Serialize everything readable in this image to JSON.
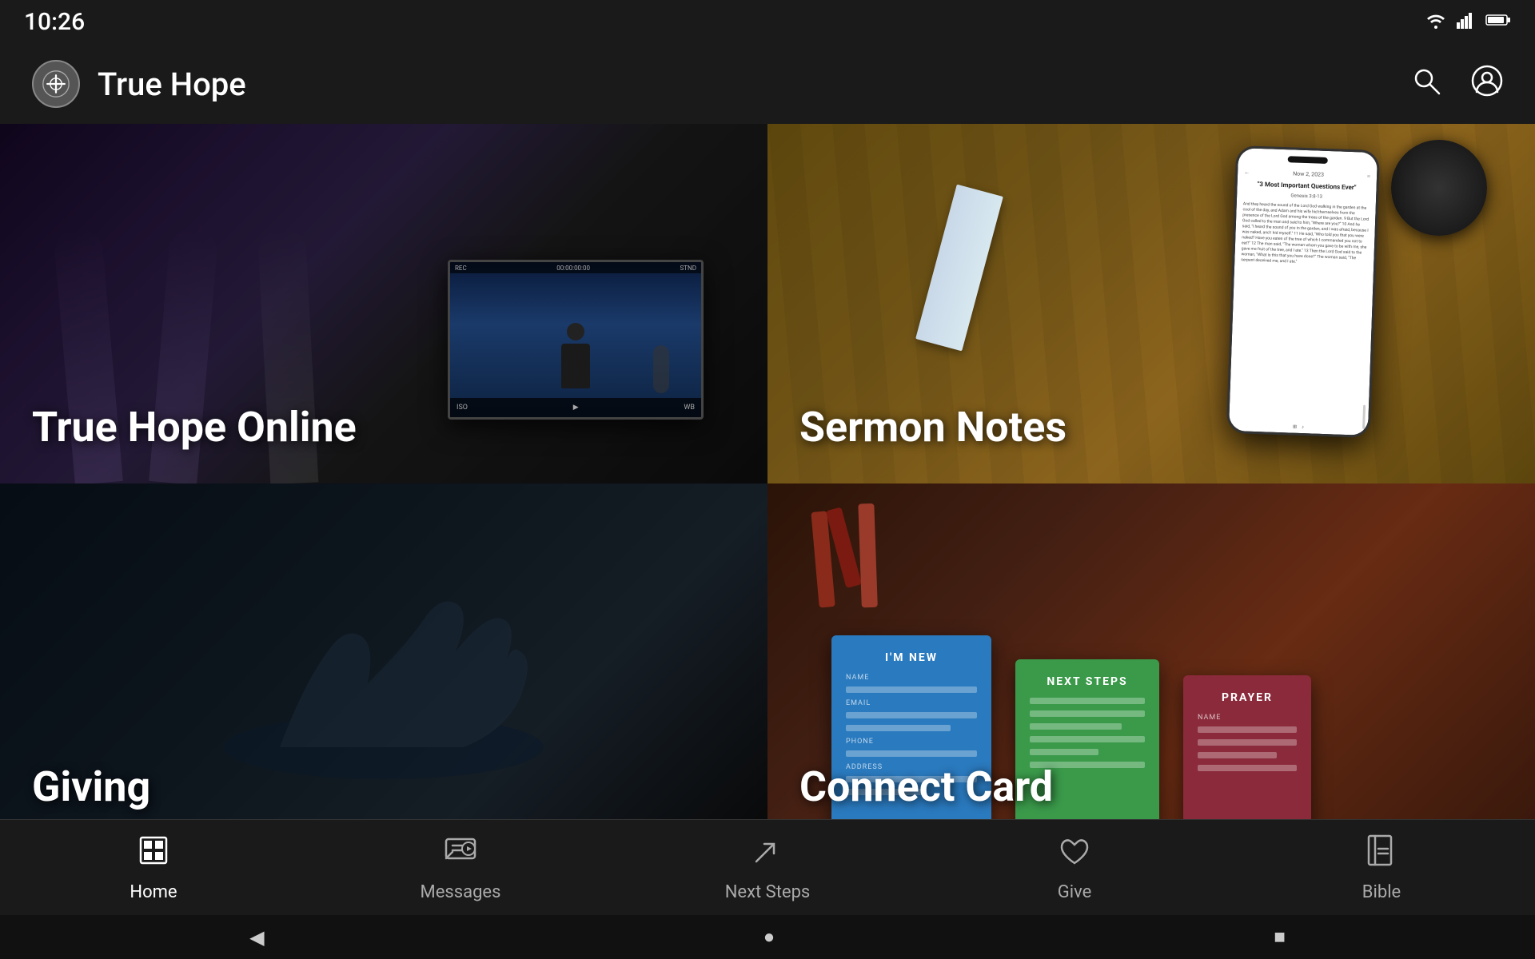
{
  "statusBar": {
    "time": "10:26",
    "icons": [
      "wifi",
      "signal",
      "battery"
    ]
  },
  "appBar": {
    "title": "True Hope",
    "logoAlt": "True Hope Logo"
  },
  "grid": {
    "cells": [
      {
        "id": "cell-1",
        "label": "True Hope Online",
        "position": "top-left"
      },
      {
        "id": "cell-2",
        "label": "Sermon Notes",
        "position": "top-right"
      },
      {
        "id": "cell-3",
        "label": "Giving",
        "position": "bottom-left"
      },
      {
        "id": "cell-4",
        "label": "Connect Card",
        "position": "bottom-right"
      }
    ]
  },
  "phoneScreen": {
    "header": "Now 2, 2023",
    "title": "\"3 Most Important Questions Ever\"",
    "subtitle": "Genesis 3:8-13",
    "bodyText": "And they heard the sound of the Lord God walking in the garden at the cool of the day, and Adam and his wife hid themselves from the presence of the Lord God among the trees of the garden. 9 But the Lord God called to the man and said to him, \"Where are you?\" 10 And he said, \"I heard the sound of you in the garden, and I was afraid, because I was naked, and I hid myself.\" 11 He said, \"Who told you that you were naked? Have you eaten of the tree of which I commanded you not to eat?\" 12 The man said, \"The woman whom you gave to be with me, she gave me fruit of the tree, and I ate.\" 13 Then the Lord God said to the woman, \"What is this that you have done?\" The woman said, \"The serpent deceived me, and I ate.\""
  },
  "connectCards": [
    {
      "id": "im-new-card",
      "title": "I'M NEW",
      "color": "#2a7abf"
    },
    {
      "id": "next-steps-card",
      "title": "NEXT STEPS",
      "color": "#3a9a4a"
    },
    {
      "id": "prayer-card",
      "title": "PRAYER",
      "color": "#8a2a3a"
    }
  ],
  "bottomNav": {
    "items": [
      {
        "id": "home",
        "label": "Home",
        "icon": "home",
        "active": true
      },
      {
        "id": "messages",
        "label": "Messages",
        "icon": "messages",
        "active": false
      },
      {
        "id": "next-steps",
        "label": "Next Steps",
        "icon": "next-steps",
        "active": false
      },
      {
        "id": "give",
        "label": "Give",
        "icon": "give",
        "active": false
      },
      {
        "id": "bible",
        "label": "Bible",
        "icon": "bible",
        "active": false
      }
    ]
  },
  "systemNav": {
    "buttons": [
      {
        "id": "back",
        "icon": "◀"
      },
      {
        "id": "home",
        "icon": "●"
      },
      {
        "id": "recent",
        "icon": "■"
      }
    ]
  }
}
